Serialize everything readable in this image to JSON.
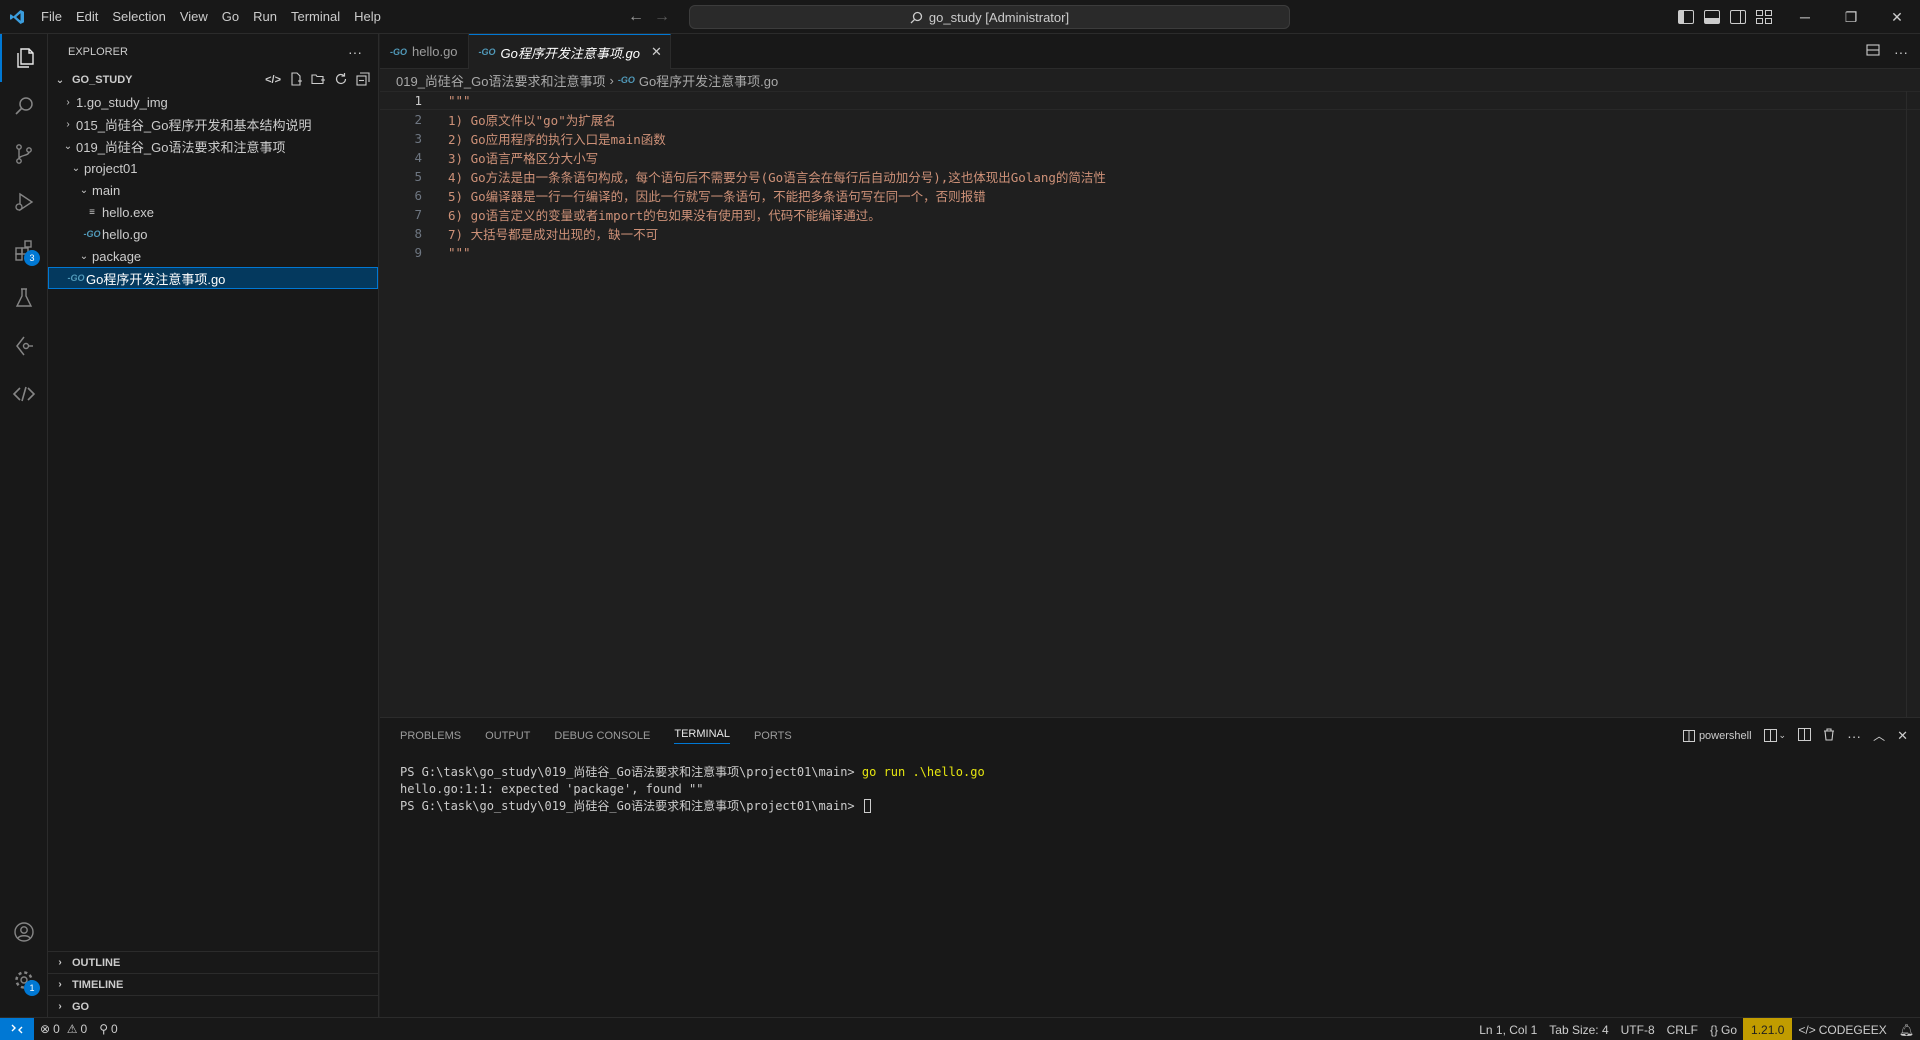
{
  "titlebar": {
    "menu": [
      "File",
      "Edit",
      "Selection",
      "View",
      "Go",
      "Run",
      "Terminal",
      "Help"
    ],
    "search_text": "go_study [Administrator]"
  },
  "activity": {
    "extensions_badge": "3",
    "settings_badge": "1"
  },
  "sidebar": {
    "title": "EXPLORER",
    "root": "GO_STUDY",
    "tree": [
      {
        "label": "1.go_study_img",
        "depth": 1,
        "type": "folder",
        "expanded": false
      },
      {
        "label": "015_尚硅谷_Go程序开发和基本结构说明",
        "depth": 1,
        "type": "folder",
        "expanded": false
      },
      {
        "label": "019_尚硅谷_Go语法要求和注意事项",
        "depth": 1,
        "type": "folder",
        "expanded": true
      },
      {
        "label": "project01",
        "depth": 2,
        "type": "folder",
        "expanded": true
      },
      {
        "label": "main",
        "depth": 3,
        "type": "folder",
        "expanded": true
      },
      {
        "label": "hello.exe",
        "depth": 4,
        "type": "exe"
      },
      {
        "label": "hello.go",
        "depth": 4,
        "type": "go"
      },
      {
        "label": "package",
        "depth": 3,
        "type": "folder",
        "expanded": true
      },
      {
        "label": "Go程序开发注意事项.go",
        "depth": 2,
        "type": "go",
        "selected": true
      }
    ],
    "bottom_sections": [
      "OUTLINE",
      "TIMELINE",
      "GO"
    ]
  },
  "editor": {
    "tabs": [
      {
        "label": "hello.go",
        "active": false
      },
      {
        "label": "Go程序开发注意事项.go",
        "active": true
      }
    ],
    "breadcrumb": [
      "019_尚硅谷_Go语法要求和注意事项",
      "Go程序开发注意事项.go"
    ],
    "lines": [
      {
        "n": "1",
        "text": "\"\"\""
      },
      {
        "n": "2",
        "text": "1) Go原文件以\"go\"为扩展名"
      },
      {
        "n": "3",
        "text": "2) Go应用程序的执行入口是main函数"
      },
      {
        "n": "4",
        "text": "3) Go语言严格区分大小写"
      },
      {
        "n": "5",
        "text": "4) Go方法是由一条条语句构成，每个语句后不需要分号(Go语言会在每行后自动加分号),这也体现出Golang的简洁性"
      },
      {
        "n": "6",
        "text": "5) Go编译器是一行一行编译的，因此一行就写一条语句，不能把多条语句写在同一个，否则报错"
      },
      {
        "n": "7",
        "text": "6) go语言定义的变量或者import的包如果没有使用到，代码不能编译通过。"
      },
      {
        "n": "8",
        "text": "7) 大括号都是成对出现的，缺一不可"
      },
      {
        "n": "9",
        "text": "\"\"\""
      }
    ]
  },
  "panel": {
    "tabs": [
      "PROBLEMS",
      "OUTPUT",
      "DEBUG CONSOLE",
      "TERMINAL",
      "PORTS"
    ],
    "active_tab": "TERMINAL",
    "shell": "powershell",
    "terminal": {
      "prompt1": "PS G:\\task\\go_study\\019_尚硅谷_Go语法要求和注意事项\\project01\\main> ",
      "cmd1": "go run .\\hello.go",
      "output1": "hello.go:1:1: expected 'package', found \"\"",
      "prompt2": "PS G:\\task\\go_study\\019_尚硅谷_Go语法要求和注意事项\\project01\\main> "
    }
  },
  "statusbar": {
    "errors": "0",
    "warnings": "0",
    "ports": "0",
    "position": "Ln 1, Col 1",
    "tab_size": "Tab Size: 4",
    "encoding": "UTF-8",
    "eol": "CRLF",
    "language": "Go",
    "go_version": "1.21.0",
    "codegeex": "CODEGEEX"
  },
  "colors": {
    "accent": "#0078d4",
    "string": "#ce9178",
    "go_icon": "#519aba",
    "go_version_bg": "#c19c00"
  }
}
